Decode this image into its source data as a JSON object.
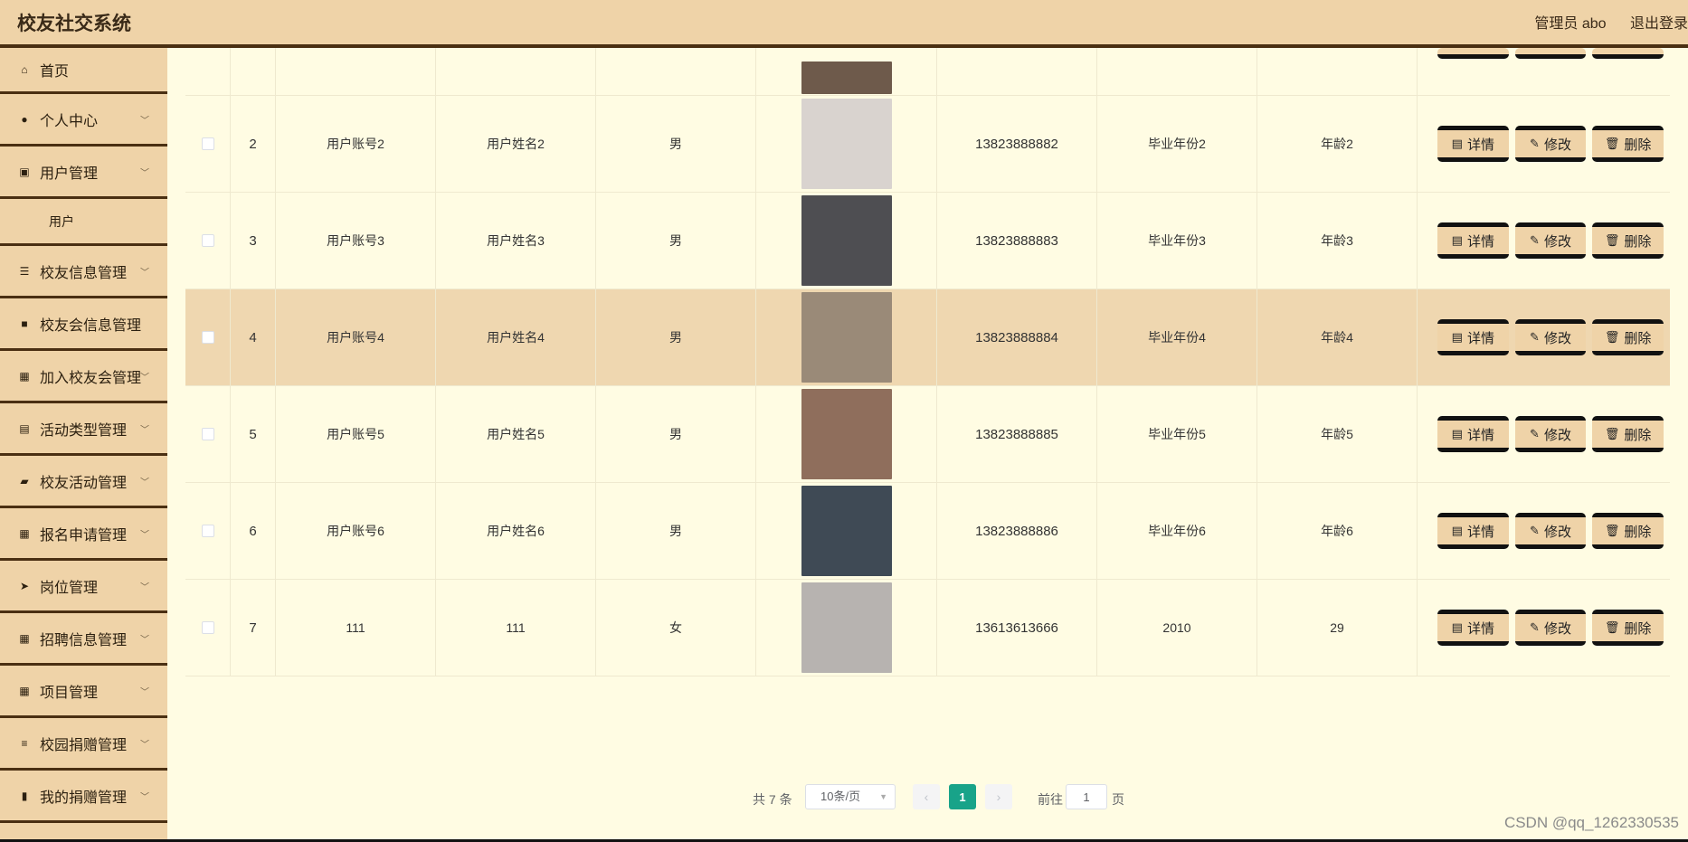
{
  "header": {
    "title": "校友社交系统",
    "user": "管理员 abo",
    "logout": "退出登录"
  },
  "sidebar": {
    "items": [
      {
        "label": "首页",
        "icon": "home-icon",
        "glyph": "⌂",
        "chevron": false
      },
      {
        "label": "个人中心",
        "icon": "user-icon",
        "glyph": "●",
        "chevron": true
      },
      {
        "label": "用户管理",
        "icon": "chart-icon",
        "glyph": "▣",
        "chevron": true,
        "sub": [
          "用户"
        ]
      },
      {
        "label": "校友信息管理",
        "icon": "sliders-icon",
        "glyph": "☰",
        "chevron": true
      },
      {
        "label": "校友会信息管理",
        "icon": "briefcase-icon",
        "glyph": "■",
        "chevron": false
      },
      {
        "label": "加入校友会管理",
        "icon": "grid-icon",
        "glyph": "▦",
        "chevron": true
      },
      {
        "label": "活动类型管理",
        "icon": "clipboard-icon",
        "glyph": "▤",
        "chevron": true
      },
      {
        "label": "校友活动管理",
        "icon": "thumb-icon",
        "glyph": "▰",
        "chevron": true
      },
      {
        "label": "报名申请管理",
        "icon": "grid-icon",
        "glyph": "▦",
        "chevron": true
      },
      {
        "label": "岗位管理",
        "icon": "send-icon",
        "glyph": "➤",
        "chevron": true
      },
      {
        "label": "招聘信息管理",
        "icon": "grid-icon",
        "glyph": "▦",
        "chevron": true
      },
      {
        "label": "项目管理",
        "icon": "grid-icon",
        "glyph": "▦",
        "chevron": true
      },
      {
        "label": "校园捐赠管理",
        "icon": "list-icon",
        "glyph": "≡",
        "chevron": true
      },
      {
        "label": "我的捐赠管理",
        "icon": "bar-chart-icon",
        "glyph": "▮",
        "chevron": true
      }
    ]
  },
  "table": {
    "actions": {
      "detail": "详情",
      "edit": "修改",
      "delete": "删除"
    },
    "rows": [
      {
        "index": "2",
        "account": "用户账号2",
        "name": "用户姓名2",
        "sex": "男",
        "phone": "13823888882",
        "year": "毕业年份2",
        "age": "年龄2",
        "avatar_color": "#d9d3cf"
      },
      {
        "index": "3",
        "account": "用户账号3",
        "name": "用户姓名3",
        "sex": "男",
        "phone": "13823888883",
        "year": "毕业年份3",
        "age": "年龄3",
        "avatar_color": "#4e4e52"
      },
      {
        "index": "4",
        "account": "用户账号4",
        "name": "用户姓名4",
        "sex": "男",
        "phone": "13823888884",
        "year": "毕业年份4",
        "age": "年龄4",
        "avatar_color": "#9a8a78"
      },
      {
        "index": "5",
        "account": "用户账号5",
        "name": "用户姓名5",
        "sex": "男",
        "phone": "13823888885",
        "year": "毕业年份5",
        "age": "年龄5",
        "avatar_color": "#8f6e5c"
      },
      {
        "index": "6",
        "account": "用户账号6",
        "name": "用户姓名6",
        "sex": "男",
        "phone": "13823888886",
        "year": "毕业年份6",
        "age": "年龄6",
        "avatar_color": "#3f4a55"
      },
      {
        "index": "7",
        "account": "111",
        "name": "111",
        "sex": "女",
        "phone": "13613613666",
        "year": "2010",
        "age": "29",
        "avatar_color": "#b7b3b0"
      }
    ]
  },
  "pagination": {
    "total": "共 7 条",
    "page_size": "10条/页",
    "current": "1",
    "goto": "前往",
    "goto_value": "1",
    "unit": "页"
  },
  "watermark": "CSDN @qq_1262330535"
}
